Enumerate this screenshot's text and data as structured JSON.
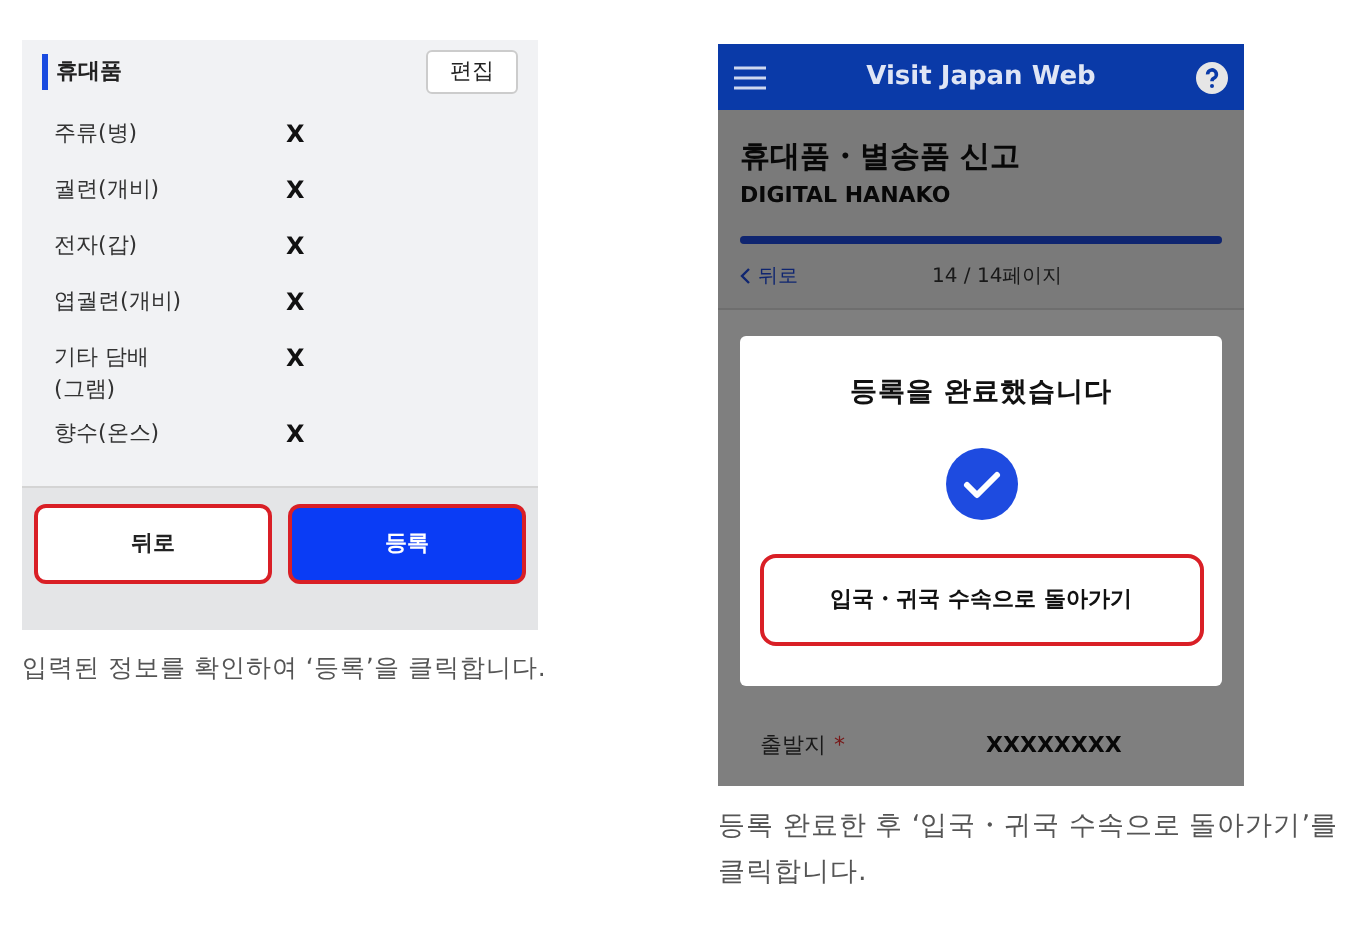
{
  "left_shot": {
    "section_title": "휴대품",
    "edit_button": "편집",
    "items": [
      {
        "label": "주류(병)",
        "value": "X"
      },
      {
        "label": "궐련(개비)",
        "value": "X"
      },
      {
        "label": "전자(갑)",
        "value": "X"
      },
      {
        "label": "엽궐련(개비)",
        "value": "X"
      },
      {
        "label": "기타 담배\n(그램)",
        "value": "X"
      },
      {
        "label": "향수(온스)",
        "value": "X"
      }
    ],
    "buttons": [
      {
        "label": "뒤로",
        "kind": "secondary"
      },
      {
        "label": "등록",
        "kind": "primary"
      }
    ]
  },
  "left_caption": "입력된 정보를 확인하여 ‘등록’을 클릭합니다.",
  "right_shot": {
    "header_title": "Visit Japan Web",
    "page_title": "휴대품・별송품 신고",
    "user_name": "DIGITAL HANAKO",
    "progress": {
      "level": 1
    },
    "back_link": "뒤로",
    "page_count": "14 / 14페이지",
    "rows": [
      {
        "label": "출발지",
        "required_mark": "*",
        "value": "XXXXXXXX"
      }
    ],
    "dialog": {
      "title": "등록을 완료했습니다",
      "button": "입국・귀국 수속으로 돌아가기"
    }
  },
  "right_caption": "등록 완료한 후 ‘입국・귀국 수속으로 돌아가기’를 클릭합니다."
}
